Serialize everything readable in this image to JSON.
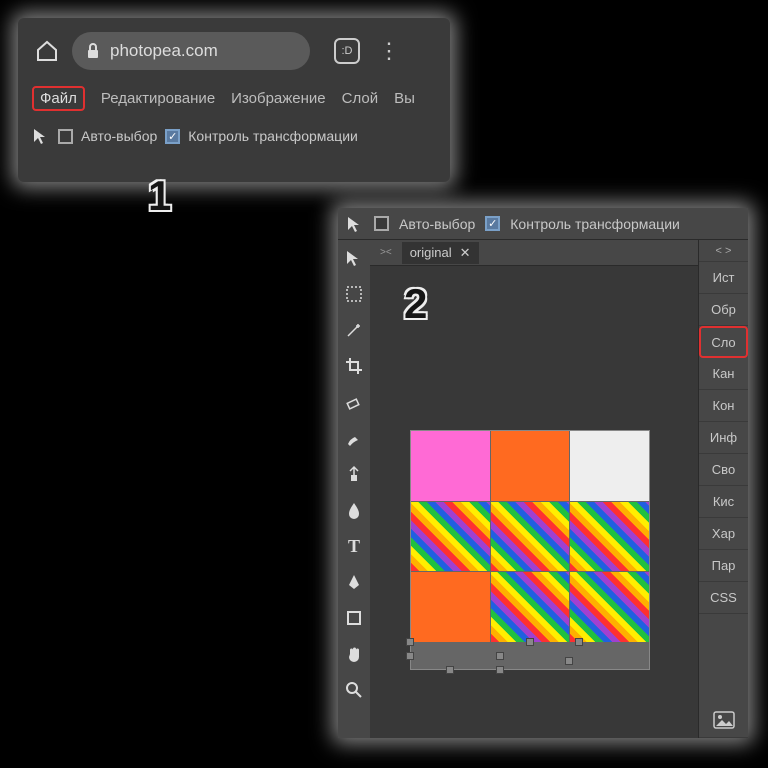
{
  "annotations": {
    "step1": "1",
    "step2": "2"
  },
  "browser": {
    "url": "photopea.com",
    "reader_badge": ":D"
  },
  "menu": {
    "file": "Файл",
    "edit": "Редактирование",
    "image": "Изображение",
    "layer": "Слой",
    "select_trunc": "Вы"
  },
  "options": {
    "auto_select": "Авто-выбор",
    "transform_controls": "Контроль трансформации",
    "auto_select_checked": false,
    "transform_checked": true
  },
  "editor": {
    "tab_name": "original",
    "text_tool_glyph": "T",
    "right_panel_expand": "< >",
    "panels": {
      "history": "Ист",
      "adjust": "Обр",
      "layers": "Сло",
      "channels": "Кан",
      "paths": "Кон",
      "info": "Инф",
      "properties": "Сво",
      "brush": "Кис",
      "character": "Хар",
      "paragraph": "Пар",
      "css": "CSS"
    }
  }
}
